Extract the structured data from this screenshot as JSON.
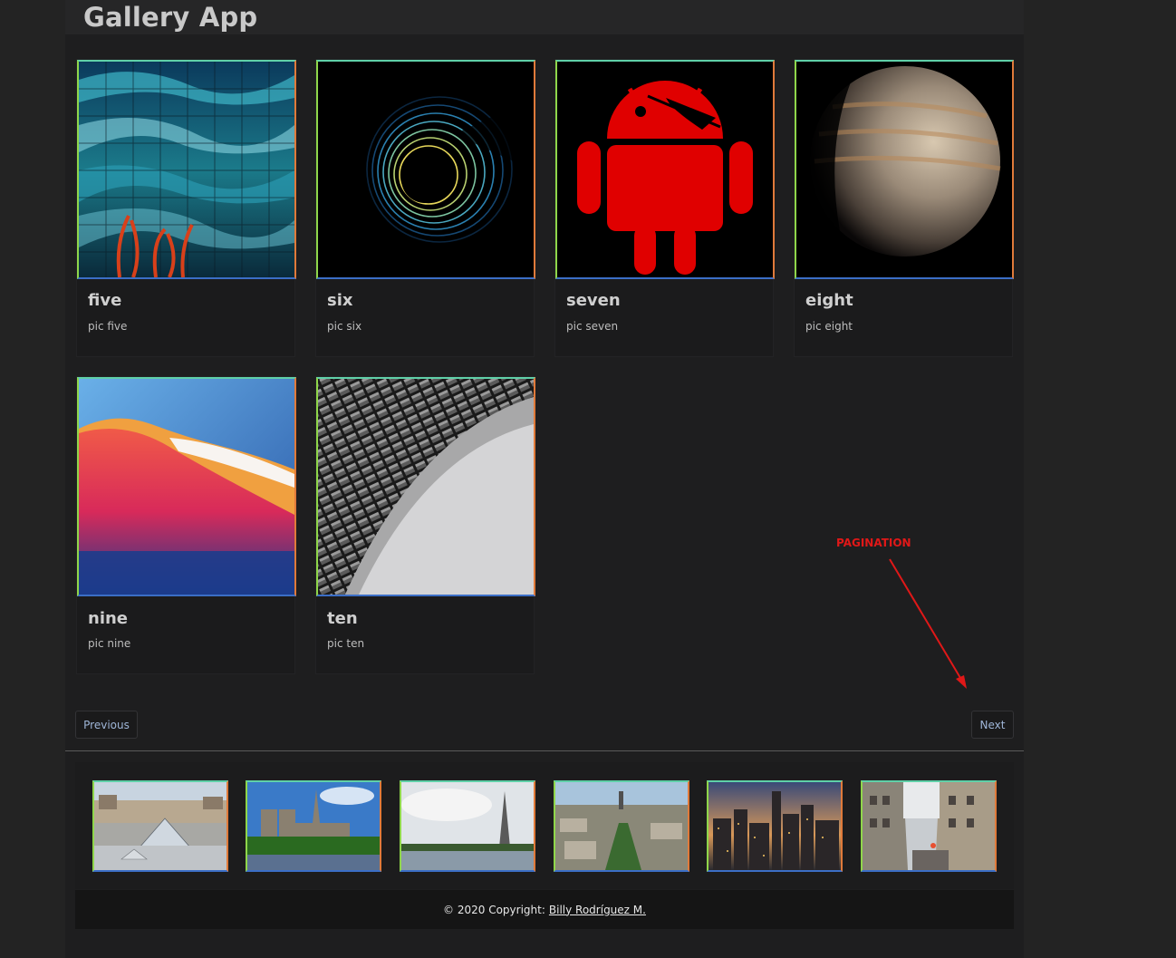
{
  "header": {
    "title": "Gallery App"
  },
  "cards": [
    {
      "title": "five",
      "subtitle": "pic five"
    },
    {
      "title": "six",
      "subtitle": "pic six"
    },
    {
      "title": "seven",
      "subtitle": "pic seven"
    },
    {
      "title": "eight",
      "subtitle": "pic eight"
    },
    {
      "title": "nine",
      "subtitle": "pic nine"
    },
    {
      "title": "ten",
      "subtitle": "pic ten"
    }
  ],
  "pagination": {
    "previous_label": "Previous",
    "next_label": "Next"
  },
  "annotation": {
    "label": "PAGINATION",
    "color": "#e01818"
  },
  "thumbnails": [
    {
      "icon": "louvre-pyramid-photo"
    },
    {
      "icon": "notre-dame-photo"
    },
    {
      "icon": "eiffel-tower-photo"
    },
    {
      "icon": "paris-aerial-photo"
    },
    {
      "icon": "city-skyline-dusk-photo"
    },
    {
      "icon": "paris-street-photo"
    }
  ],
  "footer": {
    "copyright": "© 2020 Copyright:",
    "author": "Billy Rodríguez M."
  },
  "colors": {
    "background": "#232323",
    "panel": "#1e1e1f",
    "card": "#1b1b1c",
    "button_text": "#9fb6d8",
    "footer": "#151515"
  }
}
